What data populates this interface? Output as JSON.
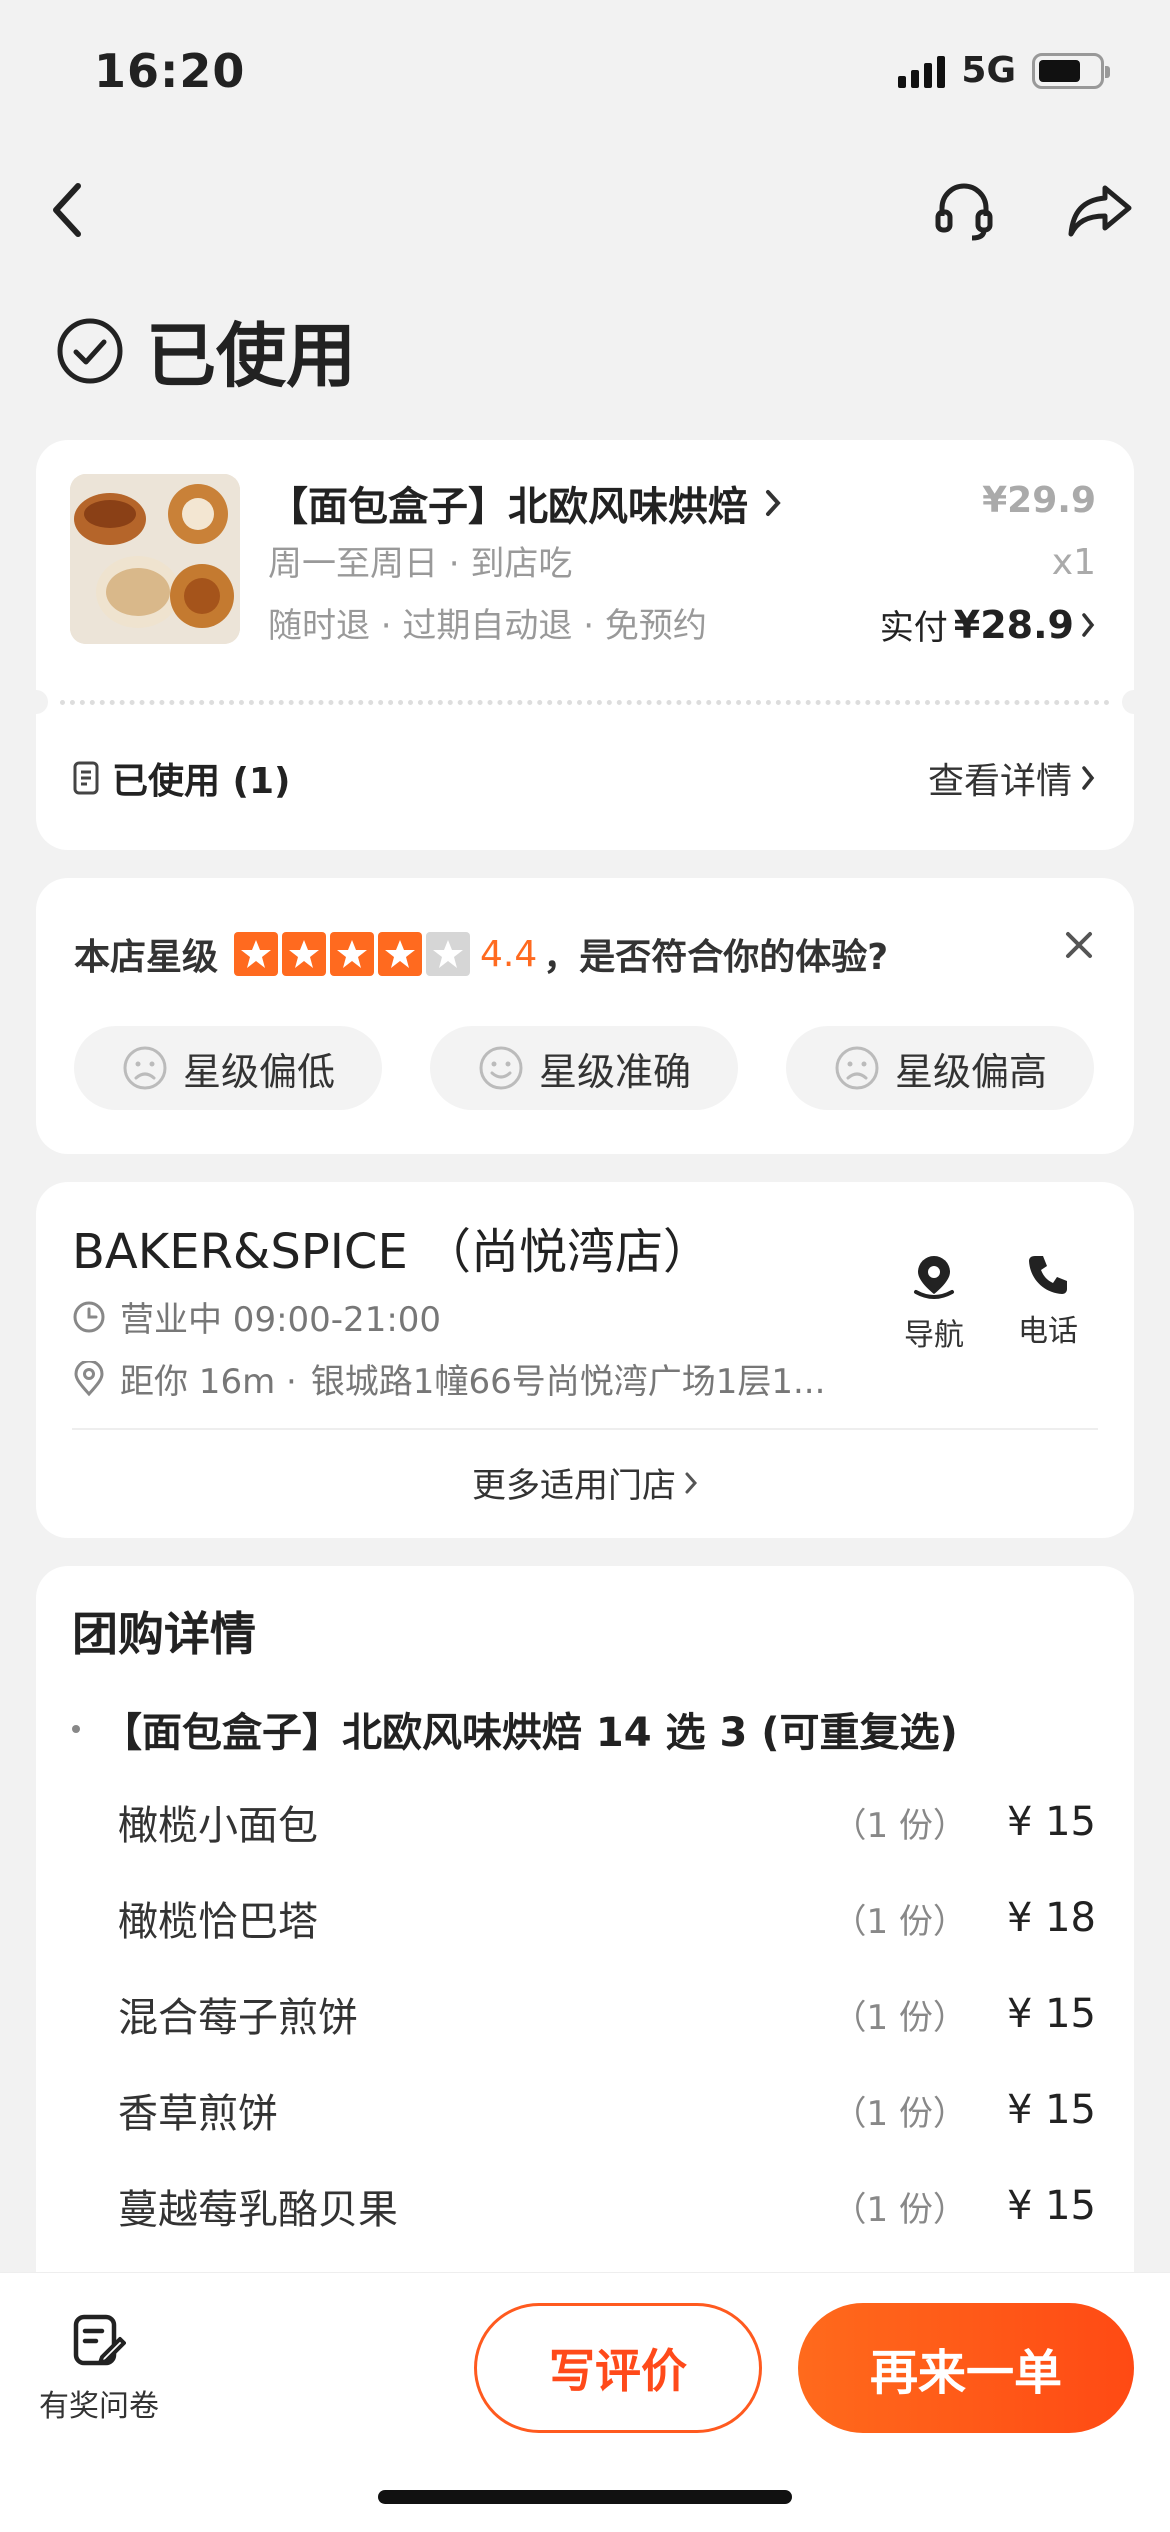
{
  "status_bar": {
    "time": "16:20",
    "network": "5G"
  },
  "page": {
    "status_title": "已使用"
  },
  "order": {
    "title": "【面包盒子】北欧风味烘焙",
    "sub1": "周一至周日 · 到店吃",
    "sub2": "随时退 · 过期自动退 · 免预约",
    "original_price": "¥29.9",
    "quantity": "x1",
    "paid_label": "实付",
    "paid_amount": "¥28.9",
    "used_label": "已使用 (1)",
    "detail_link": "查看详情"
  },
  "rating": {
    "label": "本店星级",
    "score": "4.4",
    "stars_filled": 4,
    "stars_total": 5,
    "question": "，是否符合你的体验?",
    "options": [
      "星级偏低",
      "星级准确",
      "星级偏高"
    ]
  },
  "store": {
    "name": "BAKER&SPICE （尚悦湾店）",
    "hours": "营业中 09:00-21:00",
    "distance": "距你 16m ·",
    "address": "银城路1幢66号尚悦湾广场1层1...",
    "nav_label": "导航",
    "phone_label": "电话",
    "more_stores": "更多适用门店"
  },
  "group": {
    "heading": "团购详情",
    "package": "【面包盒子】北欧风味烘焙 14 选 3 (可重复选)",
    "items": [
      {
        "name": "橄榄小面包",
        "qty": "（1 份）",
        "price": "¥ 15"
      },
      {
        "name": "橄榄恰巴塔",
        "qty": "（1 份）",
        "price": "¥ 18"
      },
      {
        "name": "混合莓子煎饼",
        "qty": "（1 份）",
        "price": "¥ 15"
      },
      {
        "name": "香草煎饼",
        "qty": "（1 份）",
        "price": "¥ 15"
      },
      {
        "name": "蔓越莓乳酪贝果",
        "qty": "（1 份）",
        "price": "¥ 15"
      }
    ]
  },
  "bottom_bar": {
    "survey_label": "有奖问卷",
    "review_button": "写评价",
    "reorder_button": "再来一单"
  },
  "colors": {
    "accent": "#ff5a1f",
    "background": "#f2f2f2"
  }
}
